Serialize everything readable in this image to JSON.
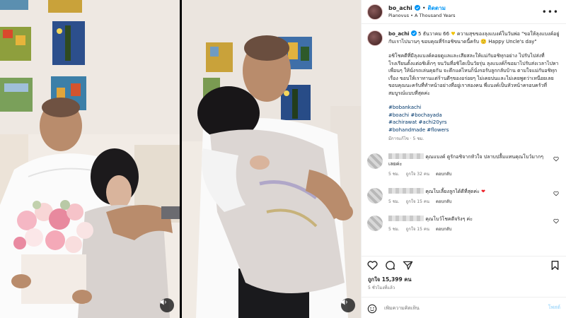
{
  "post": {
    "username": "bo_achi",
    "follow_label": "ติดตาม",
    "audio": "Pianovus • A Thousand Years",
    "caption_user": "bo_achi",
    "caption_date": "5 ธันวาคม 66",
    "caption_line1": "ความสุขของลุงแบงค์ในวันพ่อ \"ขอให้ลุงแบงค์อยู่กับเราไปนานๆ ขอบคุณที่รักอชิขนาดนี้ครับ 🙂 Happy Uncle's day\"",
    "caption_para": "อชิโชคดีที่มีลุงแบงค์คอยดูแลและเสียสละให้แม่กับอชิทุกอย่าง ไปรับไปส่งที่โรงเรียนตั้งแต่อชิเด็กๆ จนวันที่อชิโตเป็นวัยรุ่น ลุงแบงค์ก็ขอมาไปรับส่งเวลาไปหาเพื่อนๆ ให้นั่งรถเล่นคุยกัน จะดึกแค่ไหนก็นั่งรอรับลูกกลับบ้าน ตามใจแม่กับอชิทุกเรื่อง ขอบให้เราทานแต่ร้านดีๆของอร่อยๆ ไม่เคยบ่นและไม่เคยพูดว่าเหนื่อยเลย ขอบคุณนะครับที่ทำหน้าอย่างที่อยู่เราสองคน พี่แบงค์เป็นหัวหน้าครอบครัวที่สมบูรณ์แบบที่สุดค่ะ",
    "hashtags": [
      "#bobankachi",
      "#boachi #bochayada",
      "#achirawat #achi20yrs",
      "#bohandmade #flowers"
    ],
    "caption_time": "มีการแก้ไข · 5 ชม."
  },
  "comments": [
    {
      "text": "คุณแบงค์ ดูรักอชิจากหัวใจ ปลาบปลื้มแทนคุณโบว์มากๆเลยค่ะ",
      "time": "5 ชม.",
      "likes": "ถูกใจ 32 คน",
      "reply": "ตอบกลับ"
    },
    {
      "text": "คุณโบเลี้ยงลูกได้ดีที่สุดค่ะ",
      "heart": "❤",
      "time": "5 ชม.",
      "likes": "ถูกใจ 15 คน",
      "reply": "ตอบกลับ"
    },
    {
      "text": "คุณโบว์โชคดีจริงๆ ค่ะ",
      "time": "5 ชม.",
      "likes": "ถูกใจ 15 คน",
      "reply": "ตอบกลับ"
    }
  ],
  "stats": {
    "likes": "ถูกใจ 15,399 คน",
    "time": "5 ชั่วโมงที่แล้ว"
  },
  "comment_box": {
    "placeholder": "เพิ่มความคิดเห็น",
    "post_label": "โพสต์"
  },
  "colors": {
    "link": "#0095f6",
    "hashtag": "#00376b",
    "muted": "#737373"
  }
}
